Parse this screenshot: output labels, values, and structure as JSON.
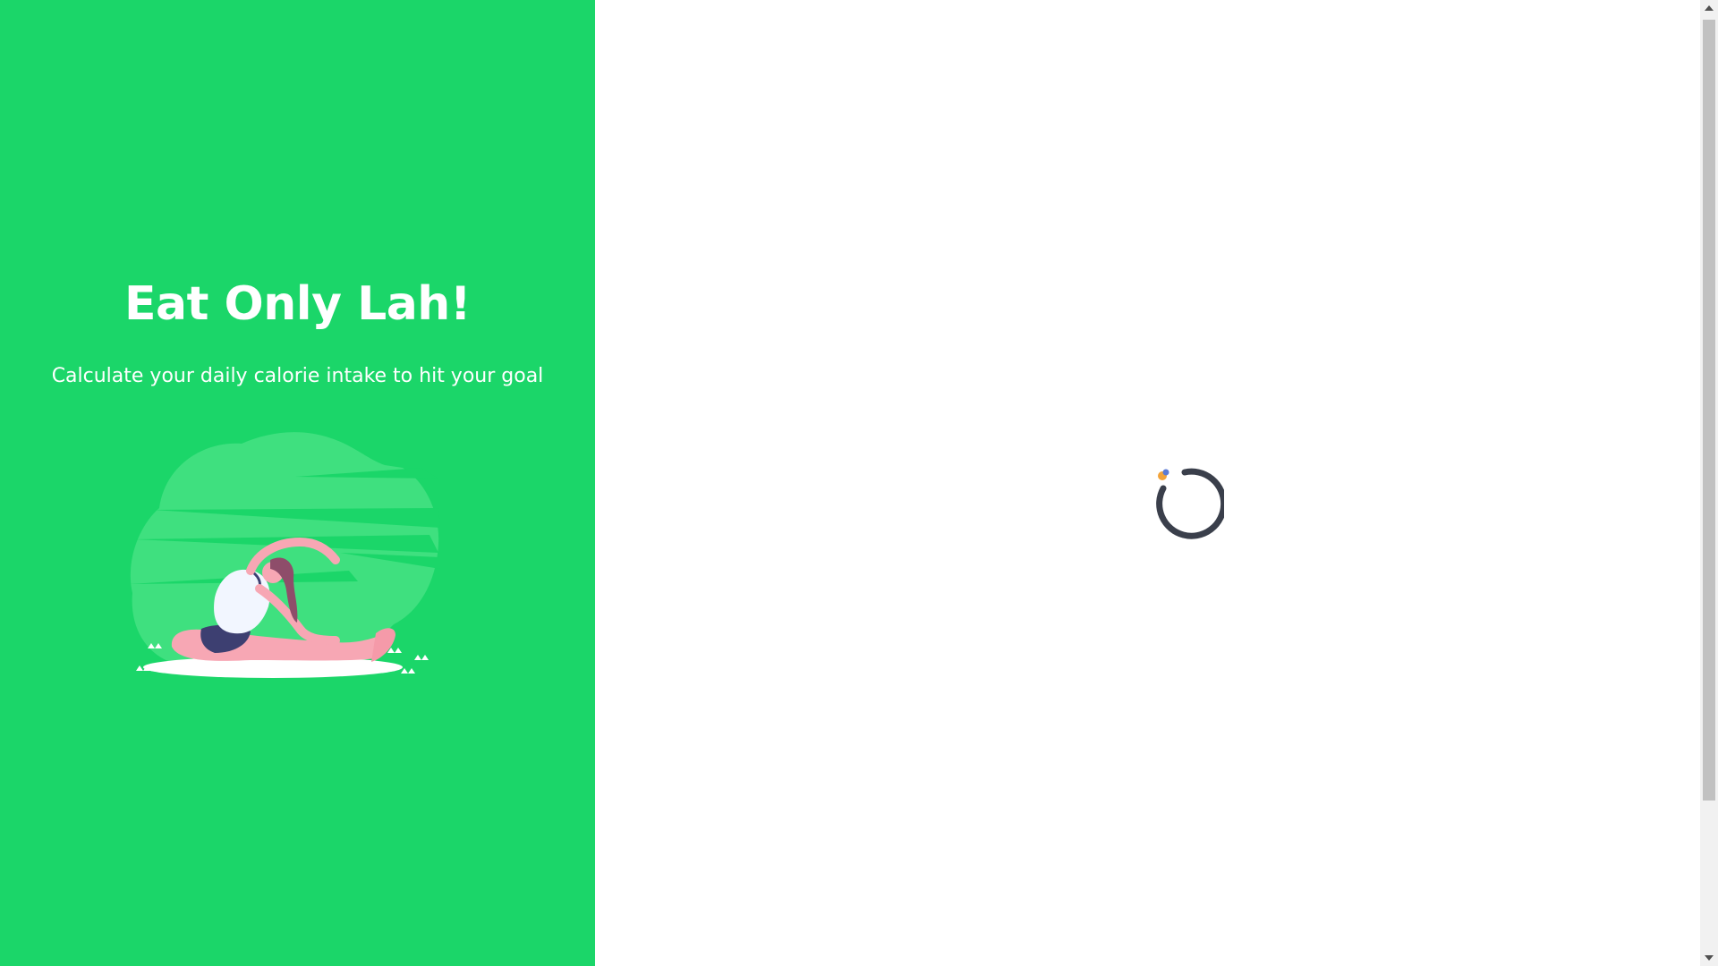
{
  "hero": {
    "title": "Eat Only Lah!",
    "subtitle": "Calculate your daily calorie intake to hit your goal",
    "illustration": "woman-yoga-stretch-illustration"
  },
  "loading": {
    "indicator": "loading-spinner-icon"
  },
  "colors": {
    "brand_green": "#1bd669",
    "spinner_dark": "#3a3f4b",
    "spinner_accent": "#f2a33a"
  },
  "scrollbar": {
    "up_icon": "chevron-up-icon",
    "down_icon": "chevron-down-icon"
  }
}
